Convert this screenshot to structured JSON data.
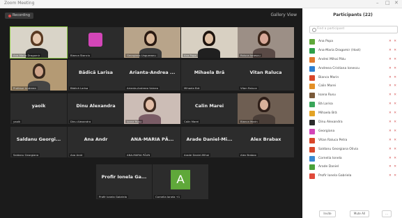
{
  "window": {
    "title": "Zoom Meeting",
    "controls": [
      "–",
      "□",
      "✕"
    ]
  },
  "meeting": {
    "recording_label": "Recording",
    "gallery_label": "Gallery View",
    "tiles": [
      {
        "name": "",
        "caption": "Ana-Maria Dragomir",
        "video": true,
        "active": true
      },
      {
        "name": "",
        "caption": "Bianca Stanciu",
        "video": false,
        "pink": true
      },
      {
        "name": "",
        "caption": "Georgiana Ungureanu",
        "video": true
      },
      {
        "name": "",
        "caption": "Ana Popa",
        "video": true
      },
      {
        "name": "",
        "caption": "Raluca Ionescu",
        "video": true
      },
      {
        "name": "",
        "caption": "Profesor Andreea",
        "video": true
      },
      {
        "name": "Bădică Larisa",
        "caption": "Bădică Larisa",
        "video": false
      },
      {
        "name": "Arianta-Andrea ...",
        "caption": "Arianta-Andreea Voinea",
        "video": false
      },
      {
        "name": "Mihaela Bră",
        "caption": "Mihaela Bră",
        "video": false
      },
      {
        "name": "Vitan Raluca",
        "caption": "Vitan Raluca",
        "video": false
      },
      {
        "name": "yaoik",
        "caption": "yaoik",
        "video": false
      },
      {
        "name": "Dinu Alexandra",
        "caption": "Dinu Alexandra",
        "video": false
      },
      {
        "name": "",
        "caption": "Ioana Rusu",
        "video": true
      },
      {
        "name": "Calin Marei",
        "caption": "Calin Marei",
        "video": false
      },
      {
        "name": "",
        "caption": "Bianca Marin",
        "video": true
      },
      {
        "name": "Saldanu Georgi...",
        "caption": "Saldanu Georgiana",
        "video": false
      },
      {
        "name": "Ana Andr",
        "caption": "Ana Andr",
        "video": false
      },
      {
        "name": "ANA-MARIA PĂ...",
        "caption": "ANA-MARIA PĂUN",
        "video": false
      },
      {
        "name": "Arade Daniel-Mi...",
        "caption": "Arade Daniel-Mihai",
        "video": false
      },
      {
        "name": "Alex Brabax",
        "caption": "Alex Brabax",
        "video": false
      },
      {
        "name": "Profir Ionela Ga...",
        "caption": "Profir Ionela Gabriela",
        "video": false
      },
      {
        "name": "",
        "caption": "Cornelia Ionela +1",
        "avatar_letter": "A"
      }
    ]
  },
  "participants": {
    "title": "Participants (22)",
    "search_placeholder": "Find a participant",
    "list": [
      {
        "name": "Ana Popa",
        "color": "#5fa83a"
      },
      {
        "name": "Ana-Maria Dragomir (Host)",
        "color": "#2f9f4a"
      },
      {
        "name": "Andrei Mihai Pălu",
        "color": "#e07a2e"
      },
      {
        "name": "Andreea Cristiana Ionescu",
        "color": "#2d7fd1"
      },
      {
        "name": "Bianca Marin",
        "color": "#d9472b"
      },
      {
        "name": "Calin Marei",
        "color": "#e38f26"
      },
      {
        "name": "Ioana Rusu",
        "color": "#7a5a3a"
      },
      {
        "name": "Bă Larisa",
        "color": "#3aa65a"
      },
      {
        "name": "Mihaela Bră",
        "color": "#e3a326"
      },
      {
        "name": "Dinu Alexandra",
        "color": "#2a2a2a"
      },
      {
        "name": "Georgiana",
        "color": "#d346b8"
      },
      {
        "name": "Vitan Raluca Petra",
        "color": "#d9472b"
      },
      {
        "name": "Saldanu Georgiana Olivia",
        "color": "#d9472b"
      },
      {
        "name": "Cornelia Ionela",
        "color": "#3a8ad1"
      },
      {
        "name": "Arade Daniel",
        "color": "#4aa13a"
      },
      {
        "name": "Profir Ionela Gabriela",
        "color": "#e04a3a"
      }
    ],
    "footer": {
      "invite": "Invite",
      "mute_all": "Mute All",
      "more": "..."
    }
  }
}
